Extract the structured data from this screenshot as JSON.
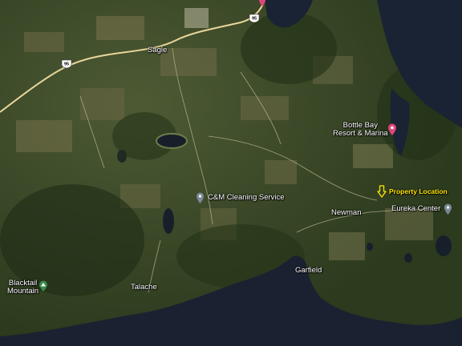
{
  "map": {
    "type": "satellite",
    "colors": {
      "forest_dark": "#243318",
      "forest": "#3a4a26",
      "field": "#6d6a46",
      "water": "#1b2433",
      "road": "#e8d59a",
      "pin_pink": "#e0467a",
      "pin_gray": "#7b8a99",
      "property_arrow": "#ffe600"
    }
  },
  "routes": [
    {
      "id": "route-95-west",
      "number": "95"
    },
    {
      "id": "route-95-east",
      "number": "95"
    }
  ],
  "labels": {
    "sagle": "Sagle",
    "newman": "Newman",
    "garfield": "Garfield",
    "talache": "Talache",
    "blacktail_line1": "Blacktail",
    "blacktail_line2": "Mountain"
  },
  "places": {
    "bottle_bay_line1": "Bottle Bay",
    "bottle_bay_line2": "Resort & Marina",
    "cm_cleaning": "C&M Cleaning Service",
    "eureka": "Eureka Center",
    "property": "Property Location"
  },
  "icons": {
    "bottle_bay": "pink-pin-icon",
    "cm_cleaning": "gray-pin-icon",
    "eureka": "gray-pin-icon",
    "blacktail": "mountain-peak-icon",
    "property": "yellow-down-arrow-icon"
  }
}
